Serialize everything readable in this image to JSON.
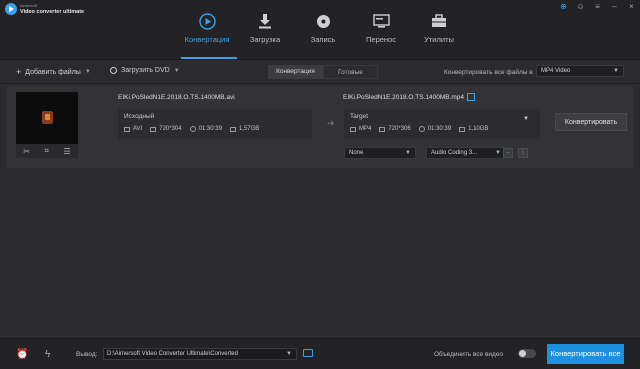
{
  "app": {
    "brand_small": "Aimersoft",
    "brand_name": "Video converter ultimate"
  },
  "nav": [
    {
      "label": "Конвертация",
      "icon": "convert-icon",
      "active": true
    },
    {
      "label": "Загрузка",
      "icon": "download-icon",
      "active": false
    },
    {
      "label": "Запись",
      "icon": "burn-disc-icon",
      "active": false
    },
    {
      "label": "Перенос",
      "icon": "transfer-icon",
      "active": false
    },
    {
      "label": "Утилиты",
      "icon": "toolbox-icon",
      "active": false
    }
  ],
  "toolbar": {
    "add_files": "Добавить файлы",
    "load_dvd": "Загрузить DVD",
    "tab_converting": "Конвертация",
    "tab_done": "Готовые",
    "convert_all_label": "Конвертировать все файлы в",
    "convert_all_format": "MP4 Video"
  },
  "task": {
    "source_filename": "EIKi.PoSledN1E.2018.O.TS.1400MB.avi",
    "source_title": "Исходный",
    "source_format": "AVI",
    "source_resolution": "720*304",
    "source_duration": "01:30:39",
    "source_size": "1,57GB",
    "target_filename": "EIKi.PoSledN1E.2018.O.TS.1400MB.mp4",
    "target_title": "Target",
    "target_format": "MP4",
    "target_resolution": "720*306",
    "target_duration": "01:30:39",
    "target_size": "1,10GB",
    "subtitle": "None",
    "audio": "Audio Coding 3...",
    "convert_button": "Конвертировать"
  },
  "bottom": {
    "output_label": "Вывод:",
    "output_path": "D:\\Aimersoft Video Converter Ultimate\\Converted",
    "merge_label": "Объединить все видео",
    "merge_enabled": false,
    "convert_all_button": "Конвертировать все"
  },
  "colors": {
    "accent": "#3aa0e8",
    "primary_button": "#1f8fe0"
  }
}
